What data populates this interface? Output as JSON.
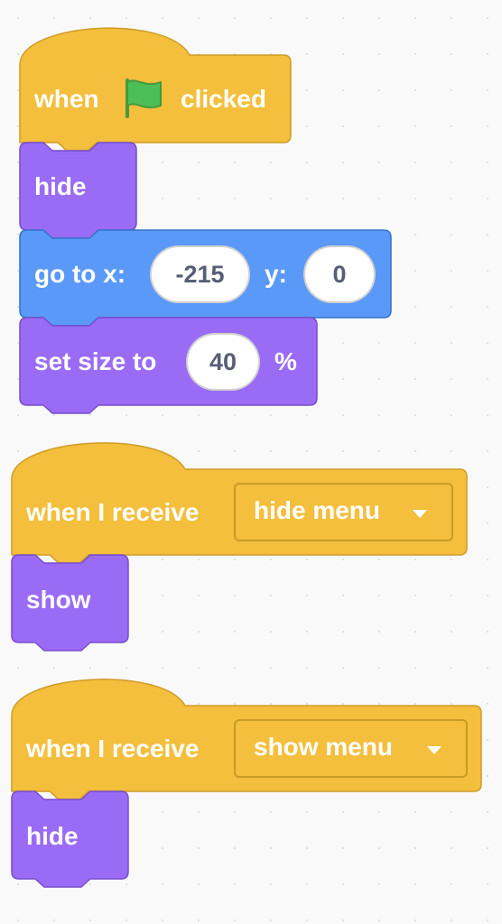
{
  "colors": {
    "events": "#ffbf00",
    "events_fill": "#f3bf3c",
    "looks": "#9966ff",
    "looks_fill": "#9a6cf6",
    "motion": "#4c97ff",
    "motion_fill": "#5a99f7",
    "canvas": "#f9f9f9"
  },
  "script1": {
    "hat": {
      "word_when": "when",
      "flag_icon": "green-flag-icon",
      "word_clicked": "clicked"
    },
    "hide": {
      "label": "hide"
    },
    "goto": {
      "label_x": "go to x:",
      "x": "-215",
      "label_y": "y:",
      "y": "0"
    },
    "set_size": {
      "label": "set size to",
      "value": "40",
      "unit": "%"
    }
  },
  "script2": {
    "hat": {
      "label": "when I receive",
      "message": "hide menu"
    },
    "show": {
      "label": "show"
    }
  },
  "script3": {
    "hat": {
      "label": "when I receive",
      "message": "show menu"
    },
    "hide": {
      "label": "hide"
    }
  }
}
